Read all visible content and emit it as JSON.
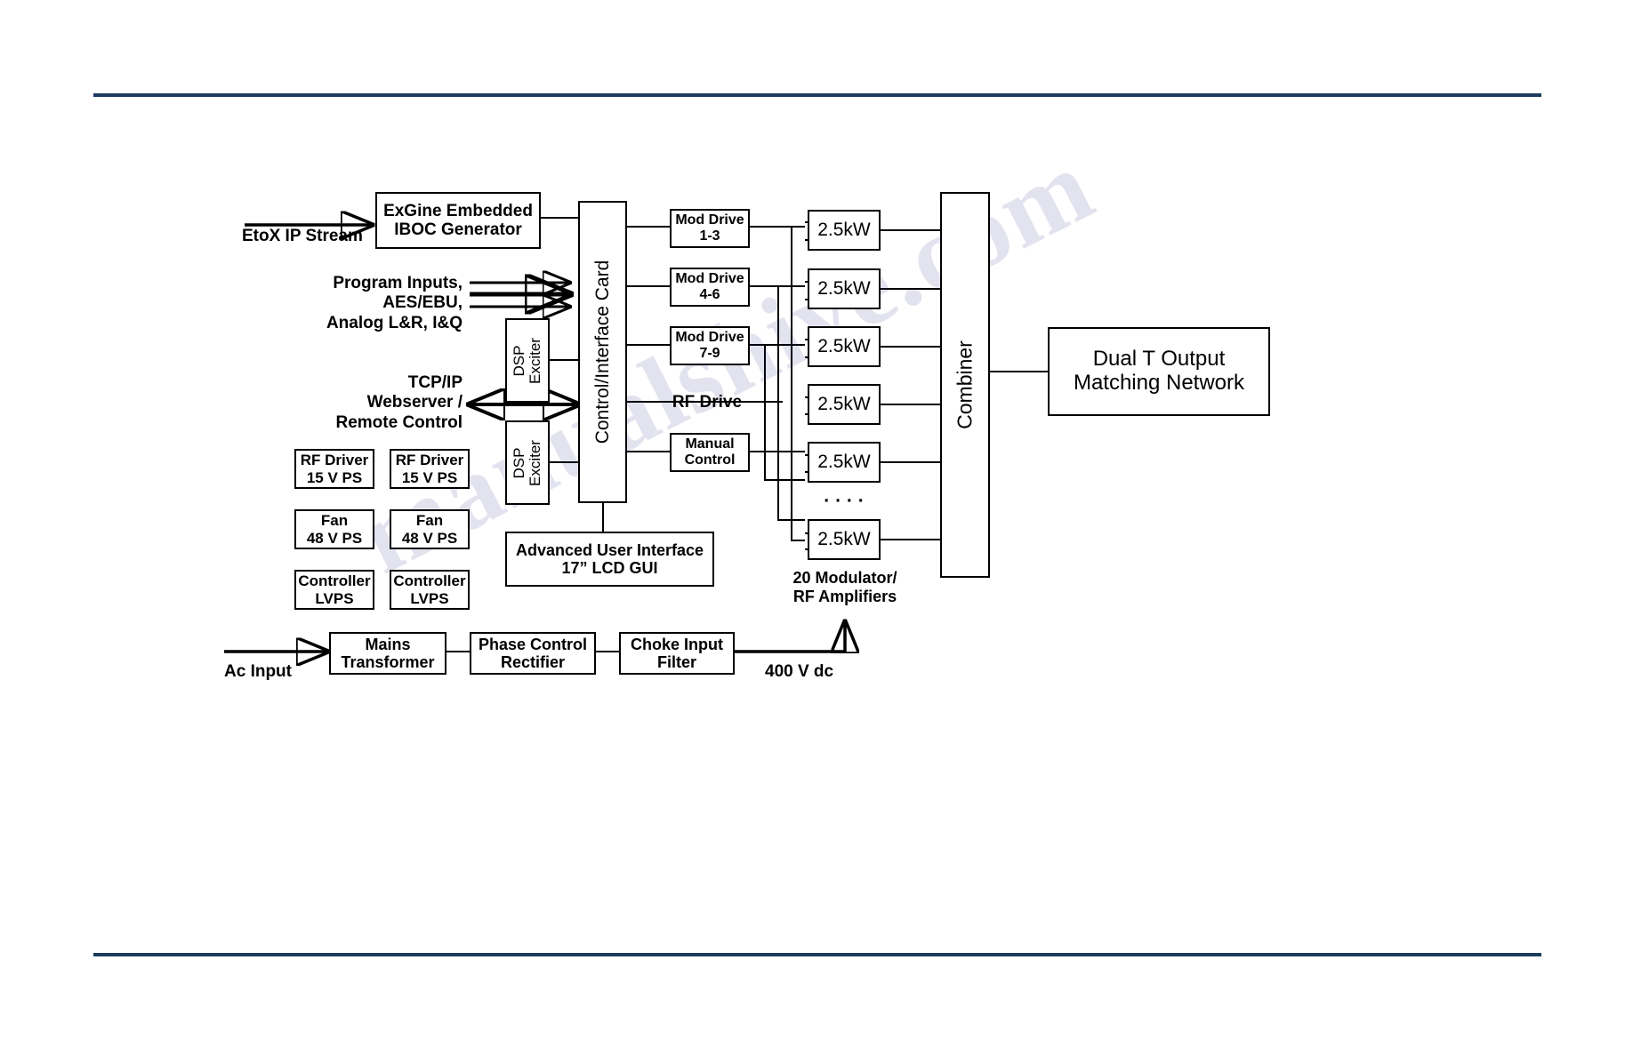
{
  "page": {
    "domain": "block-diagram",
    "watermark": "manualshive.com",
    "accent_rule_color": "#1b3c5e"
  },
  "signal_inputs": {
    "etox": "EtoX IP Stream",
    "program": "Program Inputs,\nAES/EBU,\nAnalog L&R, I&Q",
    "tcpip": "TCP/IP\nWebserver /\nRemote Control",
    "ac": "Ac Input"
  },
  "blocks": {
    "iboc": "ExGine Embedded\nIBOC Generator",
    "control_card": "Control/Interface Card",
    "dsp_exciter_1": "DSP\nExciter",
    "dsp_exciter_2": "DSP\nExciter",
    "mod_drive_1": "Mod Drive\n1-3",
    "mod_drive_2": "Mod Drive\n4-6",
    "mod_drive_3": "Mod Drive\n7-9",
    "rf_drive_label": "RF Drive",
    "manual_control": "Manual\nControl",
    "aui": "Advanced User Interface\n17” LCD GUI",
    "combiner": "Combiner",
    "dual_t": "Dual T Output\nMatching Network",
    "amps_caption": "20 Modulator/\nRF Amplifiers",
    "dc_label": "400 V dc"
  },
  "amplifiers": {
    "label": "2.5kW",
    "count_shown": 6,
    "ellipsis": "·  ·  ·  ·"
  },
  "power_supplies": [
    {
      "name": "RF Driver\n15 V PS"
    },
    {
      "name": "RF Driver\n15 V PS"
    },
    {
      "name": "Fan\n48 V PS"
    },
    {
      "name": "Fan\n48 V PS"
    },
    {
      "name": "Controller\nLVPS"
    },
    {
      "name": "Controller\nLVPS"
    }
  ],
  "power_chain": [
    {
      "name": "Mains\nTransformer"
    },
    {
      "name": "Phase Control\nRectifier"
    },
    {
      "name": "Choke Input\nFilter"
    }
  ]
}
